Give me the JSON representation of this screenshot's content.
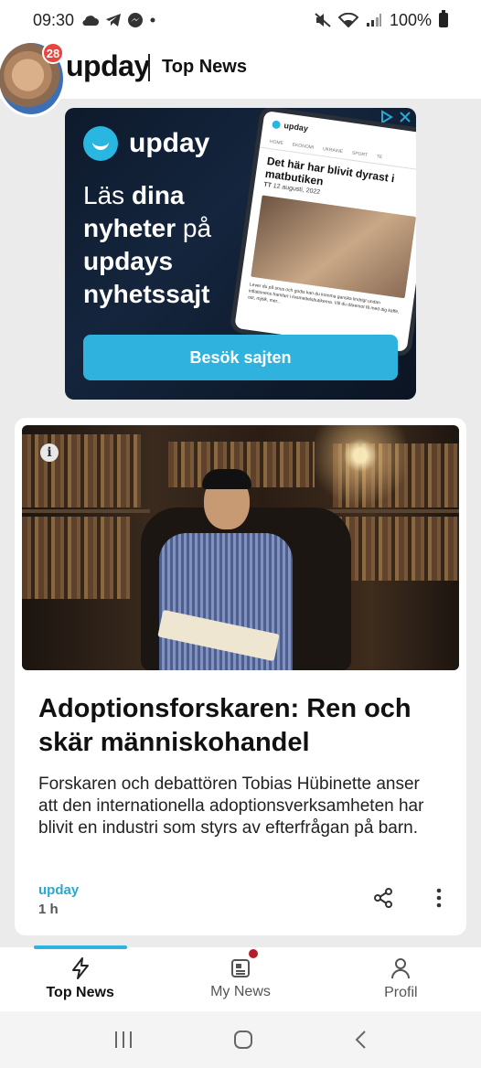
{
  "status_bar": {
    "time": "09:30",
    "battery": "100%",
    "left_icons": [
      "cloud-icon",
      "telegram-icon",
      "messenger-icon",
      "dot-icon"
    ],
    "right_icons": [
      "mute-icon",
      "wifi-icon",
      "signal-icon",
      "battery-icon"
    ]
  },
  "header": {
    "notification_count": "28",
    "brand": "upday",
    "section": "Top News"
  },
  "ad": {
    "brand": "upday",
    "headline_parts": [
      "Läs ",
      "dina",
      " nyheter",
      " på ",
      "updays nyhetssajt"
    ],
    "cta": "Besök sajten",
    "phone": {
      "brand": "upday",
      "tabs": [
        "HOME",
        "EKONOMI",
        "UKRAINE",
        "SPORT",
        "TE"
      ],
      "title": "Det här har blivit dyrast i matbutiken",
      "source": "TT",
      "date": "12 augusti, 2022",
      "body": "Lever du på snus och godis kan du komma ganska lindrigt undan inflationens framfart i livsmedelsbutikerna. Vill du däremot få med dig kaffe, ost, mjölk, mer..."
    }
  },
  "article": {
    "headline": "Adoptionsforskaren: Ren och skär människohandel",
    "summary": "Forskaren och debattören Tobias Hübinette anser att den internationella adoptionsverksamheten har blivit en industri som styrs av efterfrågan på barn.",
    "source": "upday",
    "age": "1 h"
  },
  "bottom_nav": {
    "items": [
      {
        "label": "Top News",
        "icon": "lightning-icon",
        "active": true
      },
      {
        "label": "My News",
        "icon": "news-icon",
        "active": false
      },
      {
        "label": "Profil",
        "icon": "person-icon",
        "active": false
      }
    ]
  },
  "colors": {
    "accent": "#2fb3de",
    "badge": "#e8453c",
    "source": "#29a9d0"
  }
}
